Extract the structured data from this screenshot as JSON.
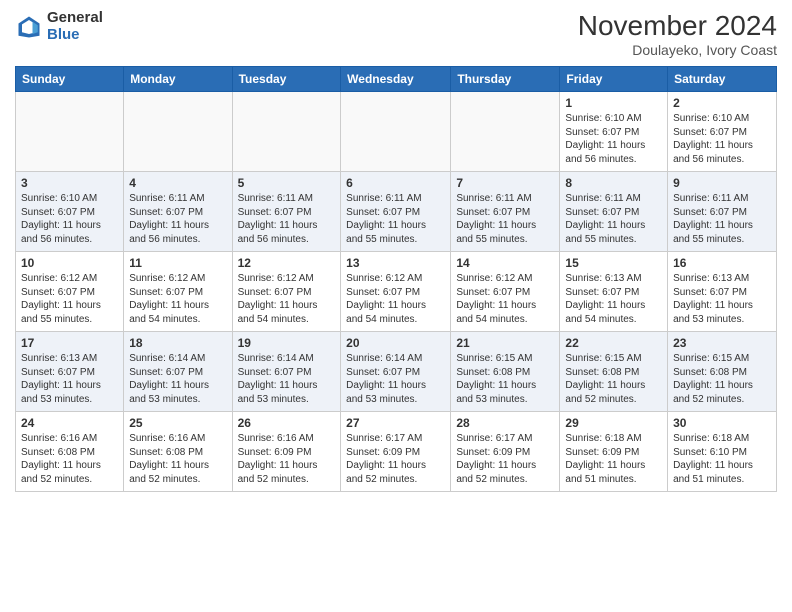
{
  "header": {
    "logo_general": "General",
    "logo_blue": "Blue",
    "month_year": "November 2024",
    "location": "Doulayeko, Ivory Coast"
  },
  "calendar": {
    "days_of_week": [
      "Sunday",
      "Monday",
      "Tuesday",
      "Wednesday",
      "Thursday",
      "Friday",
      "Saturday"
    ],
    "weeks": [
      [
        {
          "day": "",
          "info": ""
        },
        {
          "day": "",
          "info": ""
        },
        {
          "day": "",
          "info": ""
        },
        {
          "day": "",
          "info": ""
        },
        {
          "day": "",
          "info": ""
        },
        {
          "day": "1",
          "info": "Sunrise: 6:10 AM\nSunset: 6:07 PM\nDaylight: 11 hours and 56 minutes."
        },
        {
          "day": "2",
          "info": "Sunrise: 6:10 AM\nSunset: 6:07 PM\nDaylight: 11 hours and 56 minutes."
        }
      ],
      [
        {
          "day": "3",
          "info": "Sunrise: 6:10 AM\nSunset: 6:07 PM\nDaylight: 11 hours and 56 minutes."
        },
        {
          "day": "4",
          "info": "Sunrise: 6:11 AM\nSunset: 6:07 PM\nDaylight: 11 hours and 56 minutes."
        },
        {
          "day": "5",
          "info": "Sunrise: 6:11 AM\nSunset: 6:07 PM\nDaylight: 11 hours and 56 minutes."
        },
        {
          "day": "6",
          "info": "Sunrise: 6:11 AM\nSunset: 6:07 PM\nDaylight: 11 hours and 55 minutes."
        },
        {
          "day": "7",
          "info": "Sunrise: 6:11 AM\nSunset: 6:07 PM\nDaylight: 11 hours and 55 minutes."
        },
        {
          "day": "8",
          "info": "Sunrise: 6:11 AM\nSunset: 6:07 PM\nDaylight: 11 hours and 55 minutes."
        },
        {
          "day": "9",
          "info": "Sunrise: 6:11 AM\nSunset: 6:07 PM\nDaylight: 11 hours and 55 minutes."
        }
      ],
      [
        {
          "day": "10",
          "info": "Sunrise: 6:12 AM\nSunset: 6:07 PM\nDaylight: 11 hours and 55 minutes."
        },
        {
          "day": "11",
          "info": "Sunrise: 6:12 AM\nSunset: 6:07 PM\nDaylight: 11 hours and 54 minutes."
        },
        {
          "day": "12",
          "info": "Sunrise: 6:12 AM\nSunset: 6:07 PM\nDaylight: 11 hours and 54 minutes."
        },
        {
          "day": "13",
          "info": "Sunrise: 6:12 AM\nSunset: 6:07 PM\nDaylight: 11 hours and 54 minutes."
        },
        {
          "day": "14",
          "info": "Sunrise: 6:12 AM\nSunset: 6:07 PM\nDaylight: 11 hours and 54 minutes."
        },
        {
          "day": "15",
          "info": "Sunrise: 6:13 AM\nSunset: 6:07 PM\nDaylight: 11 hours and 54 minutes."
        },
        {
          "day": "16",
          "info": "Sunrise: 6:13 AM\nSunset: 6:07 PM\nDaylight: 11 hours and 53 minutes."
        }
      ],
      [
        {
          "day": "17",
          "info": "Sunrise: 6:13 AM\nSunset: 6:07 PM\nDaylight: 11 hours and 53 minutes."
        },
        {
          "day": "18",
          "info": "Sunrise: 6:14 AM\nSunset: 6:07 PM\nDaylight: 11 hours and 53 minutes."
        },
        {
          "day": "19",
          "info": "Sunrise: 6:14 AM\nSunset: 6:07 PM\nDaylight: 11 hours and 53 minutes."
        },
        {
          "day": "20",
          "info": "Sunrise: 6:14 AM\nSunset: 6:07 PM\nDaylight: 11 hours and 53 minutes."
        },
        {
          "day": "21",
          "info": "Sunrise: 6:15 AM\nSunset: 6:08 PM\nDaylight: 11 hours and 53 minutes."
        },
        {
          "day": "22",
          "info": "Sunrise: 6:15 AM\nSunset: 6:08 PM\nDaylight: 11 hours and 52 minutes."
        },
        {
          "day": "23",
          "info": "Sunrise: 6:15 AM\nSunset: 6:08 PM\nDaylight: 11 hours and 52 minutes."
        }
      ],
      [
        {
          "day": "24",
          "info": "Sunrise: 6:16 AM\nSunset: 6:08 PM\nDaylight: 11 hours and 52 minutes."
        },
        {
          "day": "25",
          "info": "Sunrise: 6:16 AM\nSunset: 6:08 PM\nDaylight: 11 hours and 52 minutes."
        },
        {
          "day": "26",
          "info": "Sunrise: 6:16 AM\nSunset: 6:09 PM\nDaylight: 11 hours and 52 minutes."
        },
        {
          "day": "27",
          "info": "Sunrise: 6:17 AM\nSunset: 6:09 PM\nDaylight: 11 hours and 52 minutes."
        },
        {
          "day": "28",
          "info": "Sunrise: 6:17 AM\nSunset: 6:09 PM\nDaylight: 11 hours and 52 minutes."
        },
        {
          "day": "29",
          "info": "Sunrise: 6:18 AM\nSunset: 6:09 PM\nDaylight: 11 hours and 51 minutes."
        },
        {
          "day": "30",
          "info": "Sunrise: 6:18 AM\nSunset: 6:10 PM\nDaylight: 11 hours and 51 minutes."
        }
      ]
    ]
  }
}
